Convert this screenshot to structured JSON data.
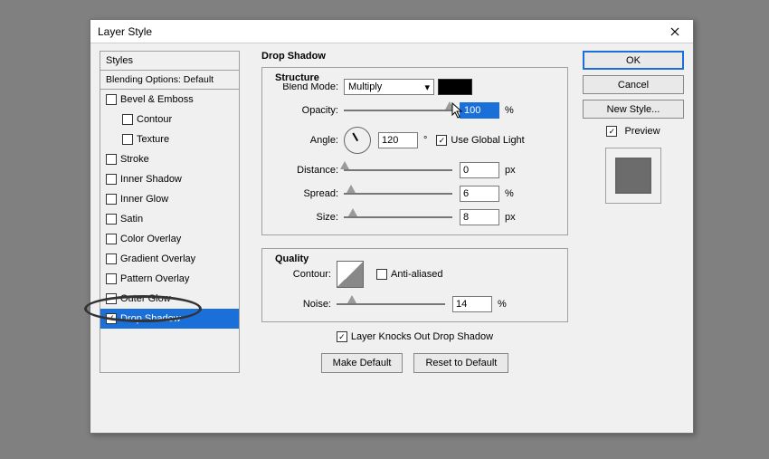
{
  "window": {
    "title": "Layer Style"
  },
  "styles_panel": {
    "header": "Styles",
    "subheader": "Blending Options: Default",
    "items": [
      {
        "label": "Bevel & Emboss",
        "checked": false,
        "indent": false
      },
      {
        "label": "Contour",
        "checked": false,
        "indent": true
      },
      {
        "label": "Texture",
        "checked": false,
        "indent": true
      },
      {
        "label": "Stroke",
        "checked": false,
        "indent": false
      },
      {
        "label": "Inner Shadow",
        "checked": false,
        "indent": false
      },
      {
        "label": "Inner Glow",
        "checked": false,
        "indent": false
      },
      {
        "label": "Satin",
        "checked": false,
        "indent": false
      },
      {
        "label": "Color Overlay",
        "checked": false,
        "indent": false
      },
      {
        "label": "Gradient Overlay",
        "checked": false,
        "indent": false
      },
      {
        "label": "Pattern Overlay",
        "checked": false,
        "indent": false
      },
      {
        "label": "Outer Glow",
        "checked": false,
        "indent": false
      },
      {
        "label": "Drop Shadow",
        "checked": true,
        "indent": false,
        "selected": true
      }
    ]
  },
  "center": {
    "title": "Drop Shadow",
    "structure": {
      "title": "Structure",
      "blend_mode_label": "Blend Mode:",
      "blend_mode_value": "Multiply",
      "color": "#000000",
      "opacity_label": "Opacity:",
      "opacity_value": "100",
      "opacity_unit": "%",
      "angle_label": "Angle:",
      "angle_value": "120",
      "angle_unit": "°",
      "use_global_label": "Use Global Light",
      "use_global_checked": true,
      "distance_label": "Distance:",
      "distance_value": "0",
      "distance_unit": "px",
      "spread_label": "Spread:",
      "spread_value": "6",
      "spread_unit": "%",
      "size_label": "Size:",
      "size_value": "8",
      "size_unit": "px"
    },
    "quality": {
      "title": "Quality",
      "contour_label": "Contour:",
      "antialiased_label": "Anti-aliased",
      "antialiased_checked": false,
      "noise_label": "Noise:",
      "noise_value": "14",
      "noise_unit": "%"
    },
    "knockout_label": "Layer Knocks Out Drop Shadow",
    "knockout_checked": true,
    "make_default": "Make Default",
    "reset_default": "Reset to Default"
  },
  "right": {
    "ok": "OK",
    "cancel": "Cancel",
    "new_style": "New Style...",
    "preview_label": "Preview",
    "preview_checked": true
  }
}
